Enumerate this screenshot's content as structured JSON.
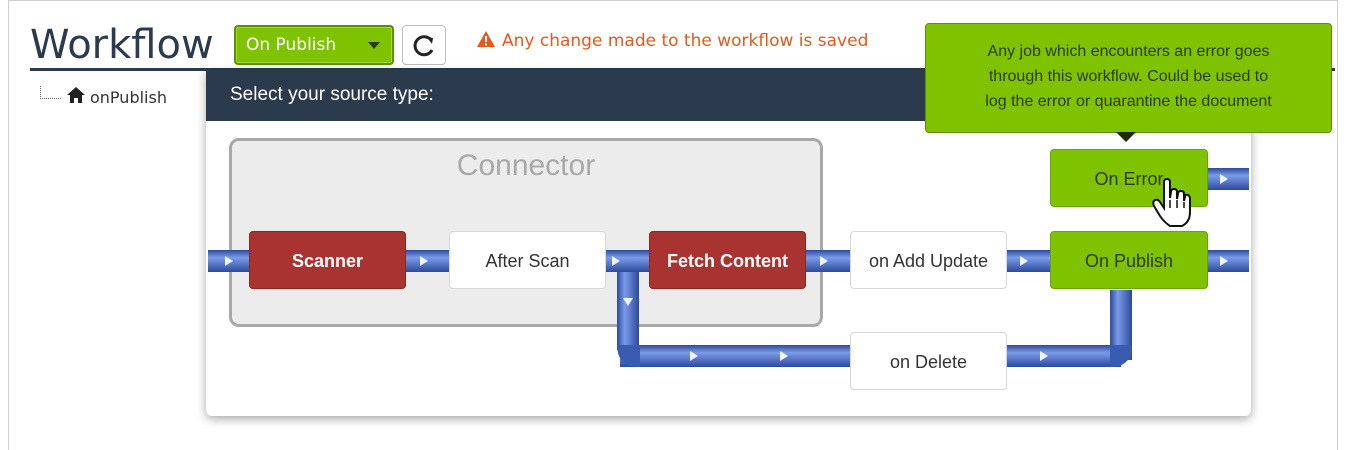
{
  "header": {
    "title": "Workflow",
    "workflow_select": "On Publish",
    "warning": "Any change made to the workflow is saved"
  },
  "tree": {
    "root_label": "onPublish"
  },
  "panel": {
    "header": "Select your source type:",
    "group_label": "Connector",
    "nodes": {
      "scanner": "Scanner",
      "after_scan": "After Scan",
      "fetch_content": "Fetch Content",
      "on_add_update": "on Add Update",
      "on_publish": "On Publish",
      "on_error": "On Error",
      "on_delete": "on Delete"
    }
  },
  "tooltip": {
    "lines": [
      "Any job which encounters an error goes",
      "through this workflow. Could be used to",
      "log the error or quarantine the document"
    ]
  },
  "colors": {
    "navy": "#2c3a4d",
    "green": "#7fc300",
    "red": "#a93331",
    "warning": "#e8571c",
    "pipe": "#4a6ec9"
  },
  "icons": [
    "home-icon",
    "refresh-icon",
    "warning-icon",
    "caret-down-icon",
    "hand-pointer-icon"
  ]
}
